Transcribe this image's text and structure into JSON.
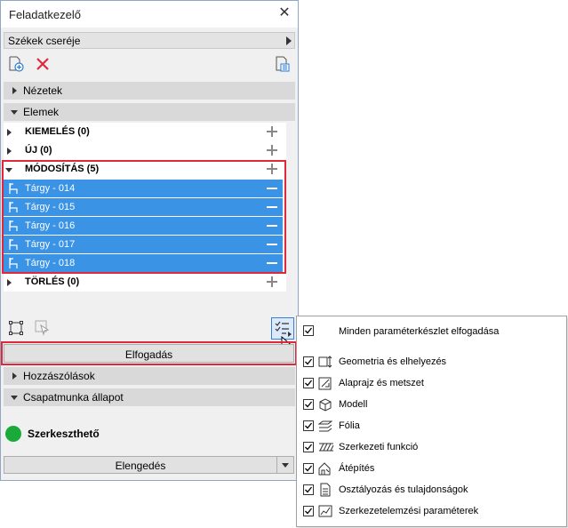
{
  "window": {
    "title": "Feladatkezelő"
  },
  "dropdown": {
    "value": "Székek cseréje"
  },
  "sections": {
    "nezetek": "Nézetek",
    "elemek": "Elemek",
    "hozzaszolasok": "Hozzászólások",
    "csapatmunka": "Csapatmunka állapot"
  },
  "groups": {
    "kiemeles": "KIEMELÉS (0)",
    "uj": "ÚJ (0)",
    "modositas": "MÓDOSÍTÁS (5)",
    "torles": "TÖRLÉS (0)"
  },
  "items": [
    {
      "label": "Tárgy - 014"
    },
    {
      "label": "Tárgy - 015"
    },
    {
      "label": "Tárgy - 016"
    },
    {
      "label": "Tárgy - 017"
    },
    {
      "label": "Tárgy - 018"
    }
  ],
  "buttons": {
    "accept": "Elfogadás",
    "release": "Elengedés"
  },
  "status": {
    "label": "Szerkeszthető",
    "color": "#1aaa3a"
  },
  "colors": {
    "selection": "#3b93e6",
    "highlight": "#e0283a"
  },
  "popup": {
    "accept_all": "Minden paraméterkészlet elfogadása",
    "items": [
      {
        "label": "Geometria és elhelyezés",
        "checked": true,
        "icon": "geometry-icon"
      },
      {
        "label": "Alaprajz és metszet",
        "checked": true,
        "icon": "floorplan-icon"
      },
      {
        "label": "Modell",
        "checked": true,
        "icon": "model-icon"
      },
      {
        "label": "Fólia",
        "checked": true,
        "icon": "layer-icon"
      },
      {
        "label": "Szerkezeti funkció",
        "checked": true,
        "icon": "structural-icon"
      },
      {
        "label": "Átépítés",
        "checked": true,
        "icon": "renovation-icon"
      },
      {
        "label": "Osztályozás és tulajdonságok",
        "checked": true,
        "icon": "classification-icon"
      },
      {
        "label": "Szerkezetelemzési paraméterek",
        "checked": true,
        "icon": "analysis-icon"
      }
    ]
  }
}
